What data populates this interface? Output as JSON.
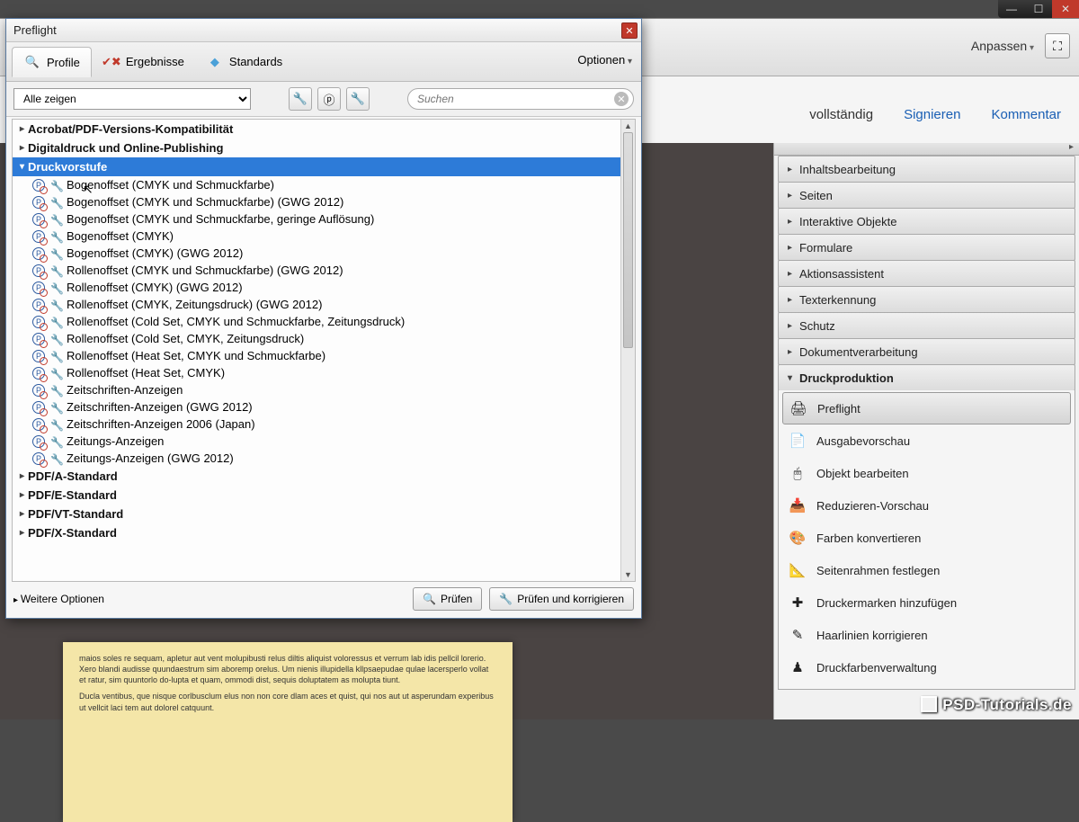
{
  "window_controls": {
    "min": "—",
    "max": "☐",
    "close": "✕"
  },
  "app": {
    "close": "✕",
    "anpassen": "Anpassen",
    "fullscreen": "⛶",
    "view_tabs": [
      "vollständig",
      "Signieren",
      "Kommentar"
    ]
  },
  "right": {
    "accordion": [
      "Inhaltsbearbeitung",
      "Seiten",
      "Interaktive Objekte",
      "Formulare",
      "Aktionsassistent",
      "Texterkennung",
      "Schutz",
      "Dokumentverarbeitung",
      "Druckproduktion"
    ],
    "tools": [
      {
        "icon": "🖨",
        "label": "Preflight",
        "selected": true
      },
      {
        "icon": "📄",
        "label": "Ausgabevorschau"
      },
      {
        "icon": "🖱",
        "label": "Objekt bearbeiten"
      },
      {
        "icon": "📥",
        "label": "Reduzieren-Vorschau"
      },
      {
        "icon": "🎨",
        "label": "Farben konvertieren"
      },
      {
        "icon": "📐",
        "label": "Seitenrahmen festlegen"
      },
      {
        "icon": "✚",
        "label": "Druckermarken hinzufügen"
      },
      {
        "icon": "✎",
        "label": "Haarlinien korrigieren"
      },
      {
        "icon": "♟",
        "label": "Druckfarbenverwaltung"
      }
    ],
    "watermark": "PSD-Tutorials.de"
  },
  "doc": {
    "p1": "maios soles re sequam, apletur aut vent molupibusti relus diltis aliquist voloressus et verrum lab idis pellcil lorerio. Xero blandi audisse quundaestrum sim aboremp orelus. Um nienis illupidella kllpsaepudae qulae lacersperlo vollat et ratur, sim quuntorlo do-lupta et quam, ommodi dist, sequis doluptatem as molupta tiunt.",
    "p2": "Ducla ventibus, que nisque corlbusclum elus non non core dlam aces et quist, qui nos aut ut asperundam experibus ut vellcit laci tem aut dolorel catquunt."
  },
  "dialog": {
    "title": "Preflight",
    "tabs": {
      "profile": "Profile",
      "ergebnisse": "Ergebnisse",
      "standards": "Standards"
    },
    "optionen": "Optionen",
    "filter": "Alle zeigen",
    "search_placeholder": "Suchen",
    "groups": [
      {
        "label": "Acrobat/PDF-Versions-Kompatibilität",
        "open": false
      },
      {
        "label": "Digitaldruck und Online-Publishing",
        "open": false
      },
      {
        "label": "Druckvorstufe",
        "open": true,
        "selected": true,
        "children": [
          "Bogenoffset (CMYK und Schmuckfarbe)",
          "Bogenoffset (CMYK und Schmuckfarbe) (GWG 2012)",
          "Bogenoffset (CMYK und Schmuckfarbe, geringe Auflösung)",
          "Bogenoffset (CMYK)",
          "Bogenoffset (CMYK) (GWG 2012)",
          "Rollenoffset (CMYK und Schmuckfarbe) (GWG 2012)",
          "Rollenoffset (CMYK) (GWG 2012)",
          "Rollenoffset (CMYK, Zeitungsdruck) (GWG 2012)",
          "Rollenoffset (Cold Set, CMYK und Schmuckfarbe, Zeitungsdruck)",
          "Rollenoffset (Cold Set, CMYK, Zeitungsdruck)",
          "Rollenoffset (Heat Set, CMYK und Schmuckfarbe)",
          "Rollenoffset (Heat Set, CMYK)",
          "Zeitschriften-Anzeigen",
          "Zeitschriften-Anzeigen (GWG 2012)",
          "Zeitschriften-Anzeigen 2006 (Japan)",
          "Zeitungs-Anzeigen",
          "Zeitungs-Anzeigen (GWG 2012)"
        ]
      },
      {
        "label": "PDF/A-Standard",
        "open": false
      },
      {
        "label": "PDF/E-Standard",
        "open": false
      },
      {
        "label": "PDF/VT-Standard",
        "open": false
      },
      {
        "label": "PDF/X-Standard",
        "open": false
      }
    ],
    "weitere": "Weitere Optionen",
    "pruefen": "Prüfen",
    "pruefen_korr": "Prüfen und korrigieren"
  }
}
